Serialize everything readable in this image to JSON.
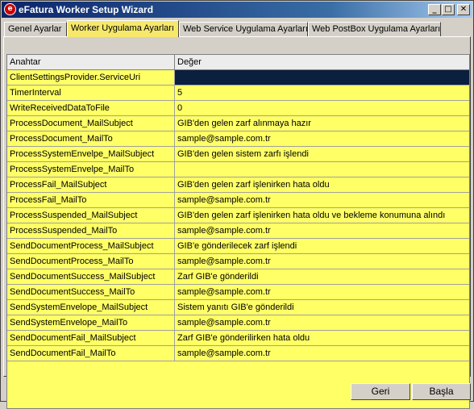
{
  "window": {
    "title": "eFatura Worker Setup Wizard",
    "app_icon_glyph": "e",
    "controls": {
      "minimize": "_",
      "maximize": "□",
      "close": "✕"
    }
  },
  "tabs": [
    {
      "label": "Genel Ayarlar",
      "active": false
    },
    {
      "label": "Worker Uygulama Ayarları",
      "active": true
    },
    {
      "label": "Web Service Uygulama Ayarları",
      "active": false
    },
    {
      "label": "Web PostBox Uygulama Ayarları",
      "active": false
    }
  ],
  "grid": {
    "columns": [
      "Anahtar",
      "Değer"
    ],
    "rows": [
      [
        "ClientSettingsProvider.ServiceUri",
        ""
      ],
      [
        "TimerInterval",
        "5"
      ],
      [
        "WriteReceivedDataToFile",
        "0"
      ],
      [
        "ProcessDocument_MailSubject",
        "GIB'den gelen zarf alınmaya hazır"
      ],
      [
        "ProcessDocument_MailTo",
        "sample@sample.com.tr"
      ],
      [
        "ProcessSystemEnvelpe_MailSubject",
        "GIB'den gelen sistem zarfı işlendi"
      ],
      [
        "ProcessSystemEnvelpe_MailTo",
        ""
      ],
      [
        "ProcessFail_MailSubject",
        "GIB'den gelen zarf işlenirken hata oldu"
      ],
      [
        "ProcessFail_MailTo",
        "sample@sample.com.tr"
      ],
      [
        "ProcessSuspended_MailSubject",
        "GIB'den gelen zarf işlenirken hata oldu ve bekleme konumuna alındı"
      ],
      [
        "ProcessSuspended_MailTo",
        "sample@sample.com.tr"
      ],
      [
        "SendDocumentProcess_MailSubject",
        "GIB'e gönderilecek zarf işlendi"
      ],
      [
        "SendDocumentProcess_MailTo",
        "sample@sample.com.tr"
      ],
      [
        "SendDocumentSuccess_MailSubject",
        "Zarf GIB'e gönderildi"
      ],
      [
        "SendDocumentSuccess_MailTo",
        "sample@sample.com.tr"
      ],
      [
        "SendSystemEnvelope_MailSubject",
        "Sistem yanıtı GIB'e gönderildi"
      ],
      [
        "SendSystemEnvelope_MailTo",
        "sample@sample.com.tr"
      ],
      [
        "SendDocumentFail_MailSubject",
        "Zarf GIB'e gönderilirken hata oldu"
      ],
      [
        "SendDocumentFail_MailTo",
        "sample@sample.com.tr"
      ]
    ],
    "selected_row": 0
  },
  "footer": {
    "back_label": "Geri",
    "start_label": "Başla"
  },
  "colors": {
    "grid_background": "#ffff66",
    "active_tab": "#f6e86a",
    "selection": "#0b1f3f"
  }
}
